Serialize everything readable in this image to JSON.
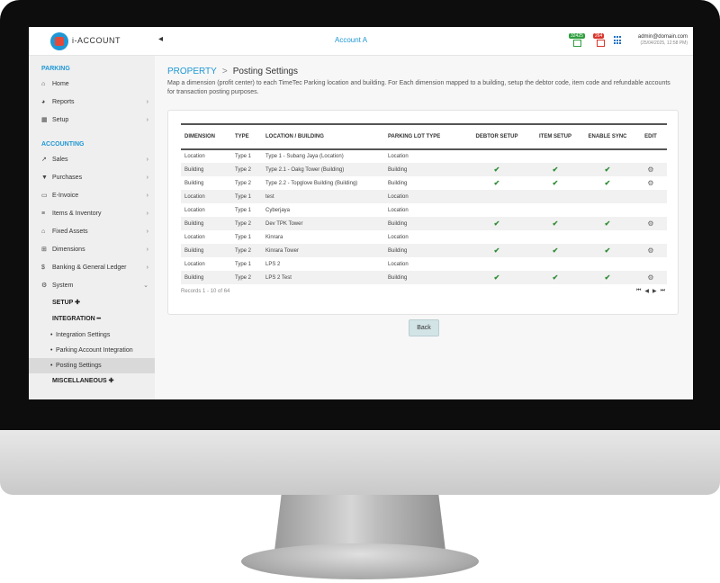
{
  "header": {
    "brand": "i-ACCOUNT",
    "collapse_icon": "◂",
    "account": "Account A",
    "badge_green": "32425",
    "badge_red": "264",
    "user": "admin@domain.com",
    "timestamp": "(25/04/2025, 12:58 PM)"
  },
  "sidebar": {
    "parking_title": "PARKING",
    "home": "Home",
    "reports": "Reports",
    "setup": "Setup",
    "accounting_title": "ACCOUNTING",
    "sales": "Sales",
    "purchases": "Purchases",
    "einvoice": "E-Invoice",
    "items": "Items & Inventory",
    "fixed_assets": "Fixed Assets",
    "dimensions": "Dimensions",
    "banking": "Banking & General Ledger",
    "system": "System",
    "setup_sub": "SETUP ✚",
    "integration_sub": "INTEGRATION ━",
    "integration_settings": "Integration Settings",
    "parking_account_integration": "Parking Account Integration",
    "posting_settings": "Posting Settings",
    "misc_sub": "MISCELLANEOUS ✚"
  },
  "main": {
    "crumb_parent": "PROPERTY",
    "crumb_sep": ">",
    "crumb_current": "Posting Settings",
    "description": "Map a dimension (profit center) to each TimeTec Parking location and building. For Each dimension mapped to a building, setup the debtor code, item code and refundable accounts for transaction posting purposes.",
    "columns": [
      "DIMENSION",
      "TYPE",
      "LOCATION / BUILDING",
      "PARKING LOT TYPE",
      "DEBTOR SETUP",
      "ITEM SETUP",
      "ENABLE SYNC",
      "EDIT"
    ],
    "rows": [
      {
        "dimension": "Location",
        "type": "Type 1",
        "location": "Type 1 - Subang Jaya (Location)",
        "lot": "Location",
        "debtor": false,
        "item": false,
        "sync": false,
        "edit": false
      },
      {
        "dimension": "Building",
        "type": "Type 2",
        "location": "Type 2.1 - Oakg Tower (Building)",
        "lot": "Building",
        "debtor": true,
        "item": true,
        "sync": true,
        "edit": true
      },
      {
        "dimension": "Building",
        "type": "Type 2",
        "location": "Type 2.2 - Topglove Building (Building)",
        "lot": "Building",
        "debtor": true,
        "item": true,
        "sync": true,
        "edit": true
      },
      {
        "dimension": "Location",
        "type": "Type 1",
        "location": "test",
        "lot": "Location",
        "debtor": false,
        "item": false,
        "sync": false,
        "edit": false
      },
      {
        "dimension": "Location",
        "type": "Type 1",
        "location": "Cyberjaya",
        "lot": "Location",
        "debtor": false,
        "item": false,
        "sync": false,
        "edit": false
      },
      {
        "dimension": "Building",
        "type": "Type 2",
        "location": "Dev TPK Tower",
        "lot": "Building",
        "debtor": true,
        "item": true,
        "sync": true,
        "edit": true
      },
      {
        "dimension": "Location",
        "type": "Type 1",
        "location": "Kinrara",
        "lot": "Location",
        "debtor": false,
        "item": false,
        "sync": false,
        "edit": false
      },
      {
        "dimension": "Building",
        "type": "Type 2",
        "location": "Kinrara Tower",
        "lot": "Building",
        "debtor": true,
        "item": true,
        "sync": true,
        "edit": true
      },
      {
        "dimension": "Location",
        "type": "Type 1",
        "location": "LPS 2",
        "lot": "Location",
        "debtor": false,
        "item": false,
        "sync": false,
        "edit": false
      },
      {
        "dimension": "Building",
        "type": "Type 2",
        "location": "LPS 2 Test",
        "lot": "Building",
        "debtor": true,
        "item": true,
        "sync": true,
        "edit": true
      }
    ],
    "records": "Records 1 - 10 of 64",
    "back_label": "Back"
  },
  "icons": {
    "check": "check-icon",
    "gear": "gear-icon"
  }
}
